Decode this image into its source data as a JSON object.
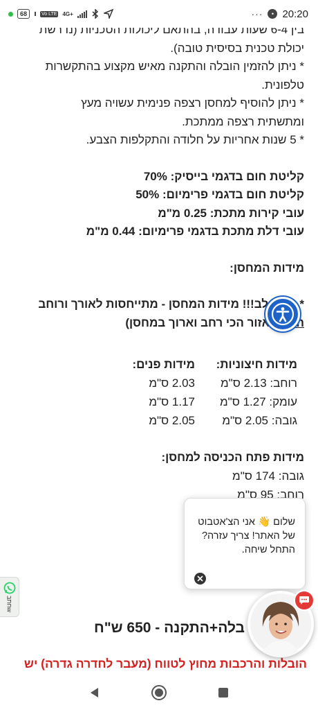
{
  "status_bar": {
    "battery": "68",
    "network_badge": "Vo LTE",
    "network_type": "4G+",
    "time": "20:20",
    "overflow_dots": "···",
    "notification_badge": "•"
  },
  "content": {
    "lines_top": [
      "בין 6-4 שעות עבודה, בהתאם ליכולות הטכניות (נדרשת",
      "יכולת טכנית בסיסית טובה).",
      "* ניתן להזמין הובלה והתקנה מאיש מקצוע בהתקשרות",
      "טלפונית.",
      "* ניתן להוסיף למחסן רצפה פנימית עשויה מעץ",
      "ומתשתית רצפה ממתכת.",
      "* 5 שנות אחריות על חלודה והתקלפות הצבע."
    ],
    "specs": [
      "קליטת חום בדגמי בייסיק: 70%",
      "קליטת חום בדגמי פרימיום: 50%",
      "עובי קירות מתכת: 0.25 מ\"מ",
      "עובי דלת מתכת בדגמי פרימיום: 0.44 מ\"מ"
    ],
    "dimensions_heading": "מידות המחסן:",
    "attention_line1": "* שימו לב!!! מידות המחסן - מתייחסות לאורך ורוחב",
    "attention_underlined": "הגג",
    "attention_line2_rest": " (האזור הכי רחב וארוך במחסן)"
  },
  "dimensions": {
    "external_header": "מידות חיצוניות:",
    "internal_header": "מידות פנים:",
    "rows": [
      {
        "external": "רוחב:  2.13 ס\"מ",
        "internal": "2.03 ס\"מ"
      },
      {
        "external": "עומק:  1.27 ס\"מ",
        "internal": "1.17 ס\"מ"
      },
      {
        "external": "גובה:  2.05 ס\"מ",
        "internal": "2.05 ס\"מ"
      }
    ]
  },
  "door": {
    "heading": "מידות פתח הכניסה למחסן:",
    "height": "גובה: 174 ס\"מ",
    "width": "רוחב: 95 ס\"מ"
  },
  "chat": {
    "message": "שלום 👋 אני הצ'אטבוט של האתר! צריך עזרה? התחל שיחה."
  },
  "whatsapp": {
    "label": "wחתב"
  },
  "footer": {
    "price": "בלה+התקנה - 650 ש\"ח",
    "red_notice": "הובלות והרכבות מחוץ לטווח (מעבר לחדרה גדרה) יש"
  },
  "colors": {
    "accessibility": "#1e64c8",
    "notice": "#d32020",
    "chat_badge": "#e53935",
    "whatsapp": "#25d366"
  }
}
